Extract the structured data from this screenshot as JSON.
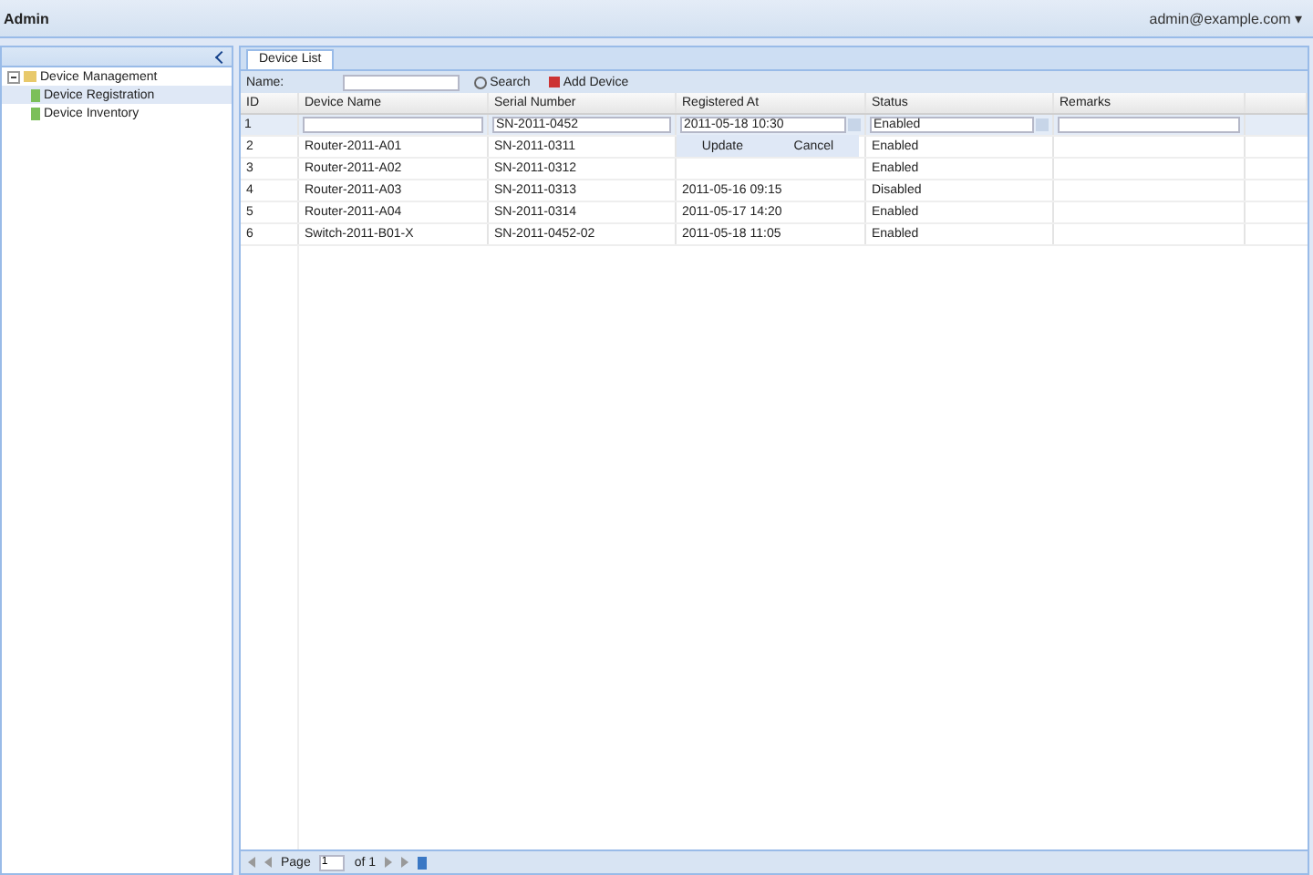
{
  "header": {
    "title": "Admin",
    "user": "admin@example.com ▾"
  },
  "sidebar": {
    "tree": [
      {
        "label": "Device Management",
        "expanded": true,
        "children": [
          {
            "label": "Device Registration",
            "selected": true
          },
          {
            "label": "Device Inventory",
            "selected": false
          }
        ]
      }
    ]
  },
  "tabs": [
    {
      "label": "Device List",
      "selected": true
    }
  ],
  "toolbar": {
    "label": "Name:",
    "search_button": "Search",
    "add_button": "Add Device"
  },
  "table": {
    "columns": [
      "ID",
      "Device Name",
      "Serial Number",
      "Registered At",
      "Status",
      "Remarks"
    ],
    "editor": {
      "id": "1",
      "serial": "SN-2011-0452",
      "date": "2011-05-18 10:30",
      "status": "Enabled",
      "update": "Update",
      "cancel": "Cancel"
    },
    "rows": [
      {
        "cells": [
          "2",
          "Router-2011-A01",
          "SN-2011-0311",
          "",
          "Enabled",
          ""
        ]
      },
      {
        "cells": [
          "3",
          "Router-2011-A02",
          "SN-2011-0312",
          "",
          "Enabled",
          ""
        ]
      },
      {
        "cells": [
          "4",
          "Router-2011-A03",
          "SN-2011-0313",
          "2011-05-16 09:15",
          "Disabled",
          ""
        ]
      },
      {
        "cells": [
          "5",
          "Router-2011-A04",
          "SN-2011-0314",
          "2011-05-17 14:20",
          "Enabled",
          ""
        ]
      },
      {
        "cells": [
          "6",
          "Switch-2011-B01-X",
          "SN-2011-0452-02",
          "2011-05-18 11:05",
          "Enabled",
          ""
        ]
      }
    ]
  },
  "pager": {
    "page_label": "Page",
    "page": "1",
    "of": "of 1"
  }
}
